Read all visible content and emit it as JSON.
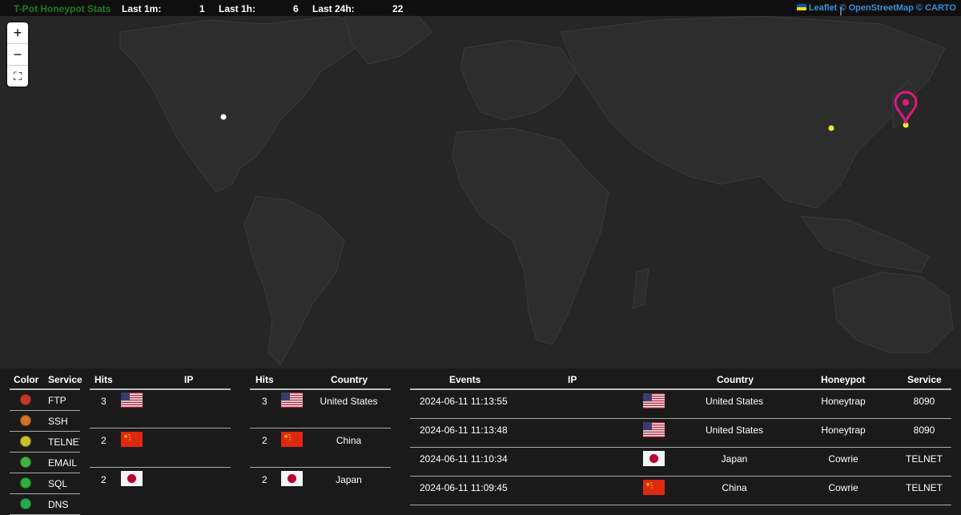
{
  "topbar": {
    "brand": "T-Pot Honeypot Stats",
    "last_1m_label": "Last 1m:",
    "last_1m_value": "1",
    "last_1h_label": "Last 1h:",
    "last_1h_value": "6",
    "last_24h_label": "Last 24h:",
    "last_24h_value": "22"
  },
  "attribution": {
    "leaflet": "Leaflet",
    "sep": "|",
    "osm": "© OpenStreetMap",
    "carto": "© CARTO"
  },
  "zoom": {
    "in": "+",
    "out": "−",
    "fullscreen": "⛶"
  },
  "legend": {
    "headers": {
      "color": "Color",
      "service": "Service"
    },
    "rows": [
      {
        "service": "FTP",
        "color": "#c0392b"
      },
      {
        "service": "SSH",
        "color": "#d4732a"
      },
      {
        "service": "TELNET",
        "color": "#c9c12c"
      },
      {
        "service": "EMAIL",
        "color": "#3fb53f"
      },
      {
        "service": "SQL",
        "color": "#2fae3f"
      },
      {
        "service": "DNS",
        "color": "#27a850"
      }
    ]
  },
  "ip_table": {
    "headers": {
      "hits": "Hits",
      "ip": "IP"
    },
    "rows": [
      {
        "hits": "3",
        "flag": "us",
        "ip": ""
      },
      {
        "hits": "2",
        "flag": "cn",
        "ip": ""
      },
      {
        "hits": "2",
        "flag": "jp",
        "ip": ""
      }
    ]
  },
  "country_table": {
    "headers": {
      "hits": "Hits",
      "country": "Country"
    },
    "rows": [
      {
        "hits": "3",
        "flag": "us",
        "country": "United States"
      },
      {
        "hits": "2",
        "flag": "cn",
        "country": "China"
      },
      {
        "hits": "2",
        "flag": "jp",
        "country": "Japan"
      }
    ]
  },
  "events_table": {
    "headers": {
      "events": "Events",
      "ip": "IP",
      "country": "Country",
      "honeypot": "Honeypot",
      "service": "Service"
    },
    "rows": [
      {
        "time": "2024-06-11 11:13:55",
        "flag": "us",
        "country": "United States",
        "honeypot": "Honeytrap",
        "service": "8090"
      },
      {
        "time": "2024-06-11 11:13:48",
        "flag": "us",
        "country": "United States",
        "honeypot": "Honeytrap",
        "service": "8090"
      },
      {
        "time": "2024-06-11 11:10:34",
        "flag": "jp",
        "country": "Japan",
        "honeypot": "Cowrie",
        "service": "TELNET"
      },
      {
        "time": "2024-06-11 11:09:45",
        "flag": "cn",
        "country": "China",
        "honeypot": "Cowrie",
        "service": "TELNET"
      }
    ]
  },
  "map_markers": [
    {
      "name": "us-marker",
      "color": "#ffffff"
    },
    {
      "name": "china-marker",
      "color": "#f5e63a"
    },
    {
      "name": "japan-marker",
      "color": "#f5e63a"
    },
    {
      "name": "japan-pin",
      "color": "#e0197d"
    }
  ]
}
